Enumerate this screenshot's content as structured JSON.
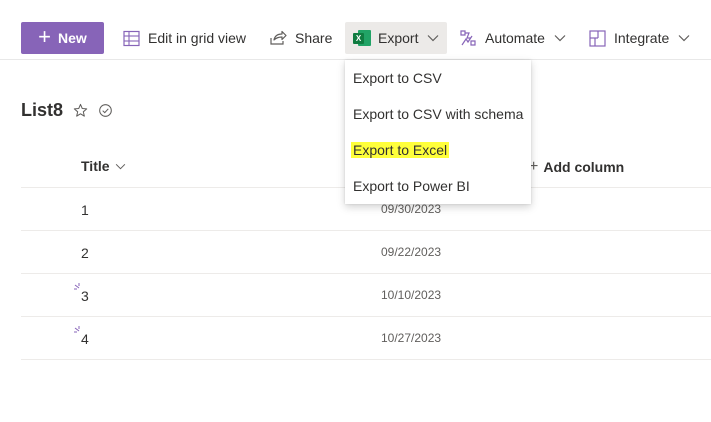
{
  "commandbar": {
    "new_label": "New",
    "edit_grid_label": "Edit in grid view",
    "share_label": "Share",
    "export_label": "Export",
    "export_icon_letter": "X",
    "automate_label": "Automate",
    "integrate_label": "Integrate"
  },
  "export_menu": {
    "items": [
      {
        "label": "Export to CSV"
      },
      {
        "label": "Export to CSV with schema"
      },
      {
        "label": "Export to Excel"
      },
      {
        "label": "Export to Power BI"
      }
    ],
    "highlight_color": "#ffff3b"
  },
  "list": {
    "title": "List8",
    "columns": {
      "title_header": "Title",
      "add_column": "Add column"
    },
    "rows": [
      {
        "title": "1",
        "date": "09/30/2023"
      },
      {
        "title": "2",
        "date": "09/22/2023"
      },
      {
        "title": "3",
        "date": "10/10/2023"
      },
      {
        "title": "4",
        "date": "10/27/2023"
      }
    ]
  },
  "colors": {
    "accent": "#8764b8",
    "excel_green": "#107c41"
  }
}
